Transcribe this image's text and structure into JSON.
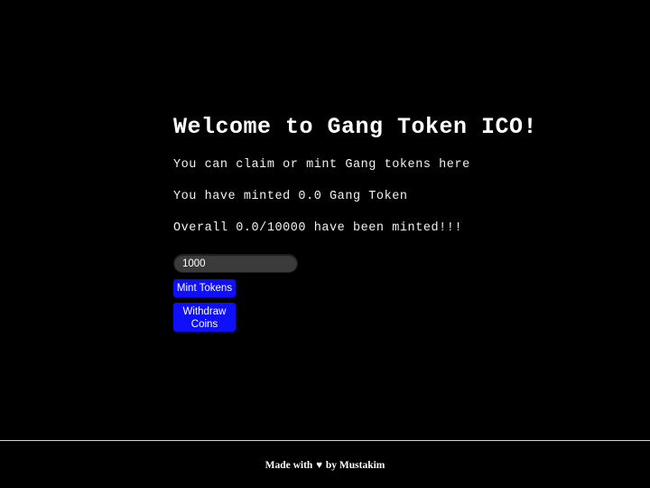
{
  "page": {
    "background_color": "#000000",
    "title": "Welcome to Gang Token ICO!"
  },
  "info": {
    "claim_line": "You can claim or mint Gang tokens here",
    "minted_line": "You have minted 0.0 Gang Token",
    "overall_line": "Overall 0.0/10000 have been minted!!!",
    "user_minted_amount": "0.0",
    "total_minted_amount": "0.0",
    "total_supply": "10000",
    "token_name": "Gang Token"
  },
  "form": {
    "amount_value": "1000",
    "amount_placeholder": "1000",
    "mint_button_label": "Mint Tokens",
    "withdraw_button_line1": "Withdraw",
    "withdraw_button_line2": "Coins",
    "button_color": "#0f0ffa",
    "input_background": "#3b3b3b"
  },
  "footer": {
    "prefix": "Made with ",
    "heart_icon": "♥",
    "suffix": " by Mustakim"
  }
}
